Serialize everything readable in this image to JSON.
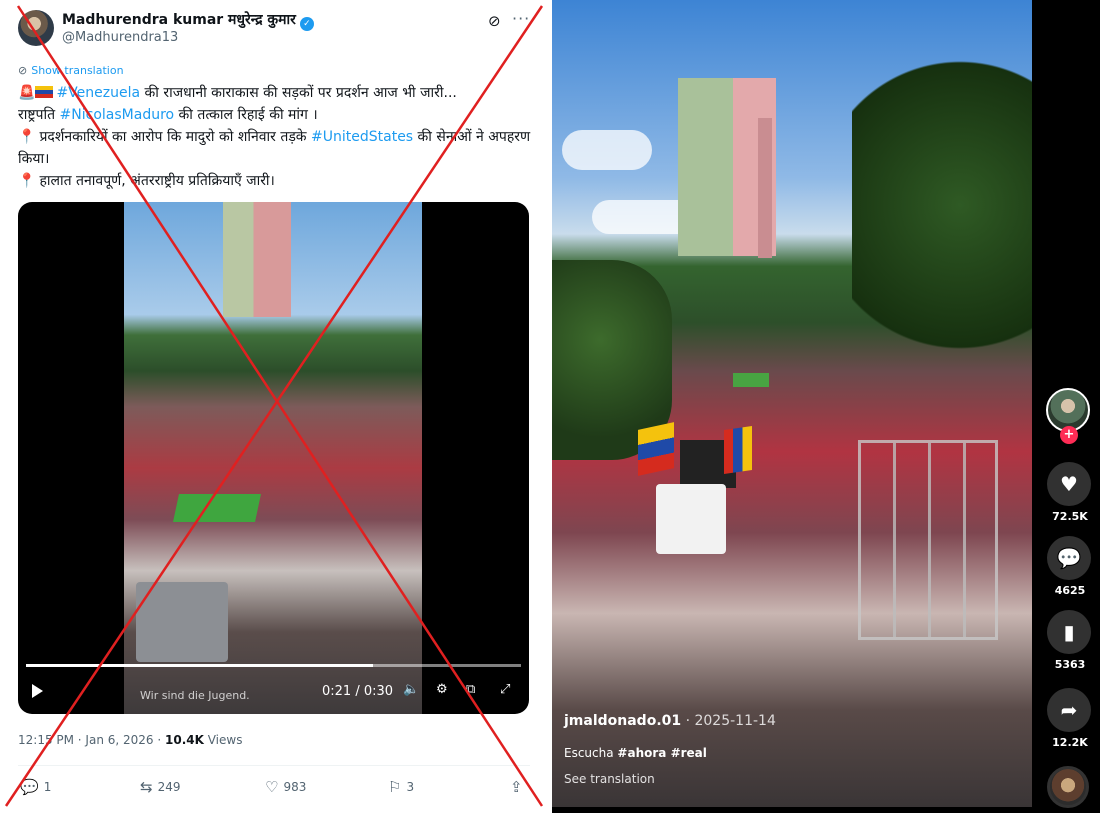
{
  "tweet": {
    "author_name": "Madhurendra kumar मधुरेन्द्र कुमार",
    "handle": "@Madhurendra13",
    "show_translation": "Show translation",
    "line1_text": " की राजधानी काराकास की सड़कों पर प्रदर्शन आज भी जारी...",
    "line1_tag": "#Venezuela",
    "line2_prefix": "राष्ट्रपति ",
    "line2_tag": "#NicolasMaduro",
    "line2_suffix": "  की तत्काल रिहाई की मांग ।",
    "line3_prefix": "प्रदर्शनकारियों का आरोप  कि मादुरो को शनिवार तड़के ",
    "line3_tag": "#UnitedStates",
    "line3_suffix": " की सेनाओं ने अपहरण किया।",
    "line4": "हालात तनावपूर्ण, अंतरराष्ट्रीय प्रतिक्रियाएँ जारी।",
    "video": {
      "caption": "Wir sind die Jugend.",
      "time": "0:21 / 0:30",
      "progress": 0.7
    },
    "timestamp": "12:15 PM · Jan 6, 2026 · ",
    "views_count": "10.4K",
    "views_label": " Views",
    "actions": {
      "replies": "1",
      "reposts": "249",
      "likes": "983",
      "bookmarks": "3"
    }
  },
  "tiktok": {
    "author": "jmaldonado.01",
    "date": " · 2025-11-14",
    "caption_word": "Escucha ",
    "tag1": "#ahora",
    "tag2": " #real",
    "see_translation": "See translation",
    "likes": "72.5K",
    "comments": "4625",
    "saves": "5363",
    "shares": "12.2K"
  },
  "colors": {
    "link_blue": "#1d9bf0",
    "cross_red": "#e02020",
    "tiktok_red": "#fe2c55"
  }
}
